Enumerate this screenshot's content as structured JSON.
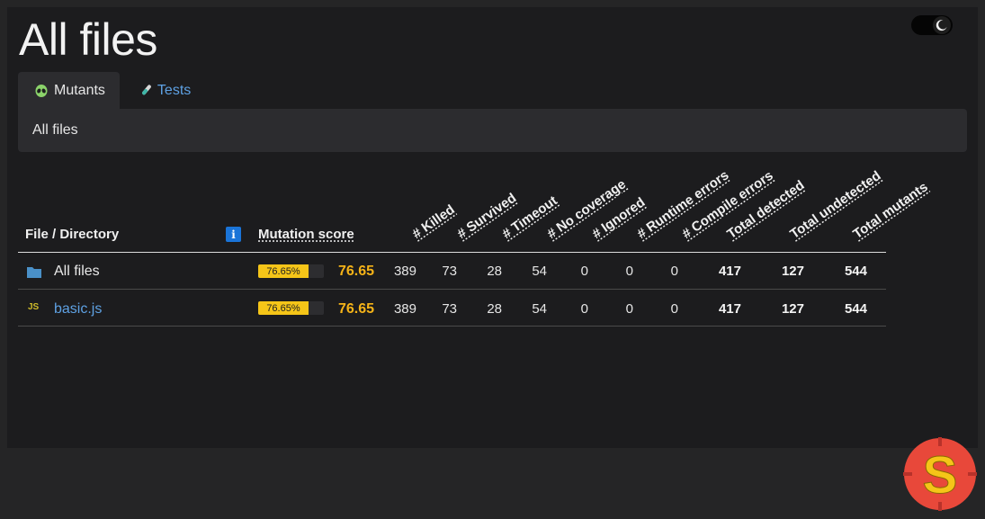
{
  "page": {
    "title": "All files",
    "theme_toggle": "dark"
  },
  "tabs": [
    {
      "label": "Mutants",
      "icon": "alien-icon",
      "active": true
    },
    {
      "label": "Tests",
      "icon": "test-tube-icon",
      "active": false
    }
  ],
  "breadcrumb": {
    "current": "All files"
  },
  "table": {
    "headers": {
      "file": "File / Directory",
      "info": "i",
      "score": "Mutation score",
      "killed": "# Killed",
      "survived": "# Survived",
      "timeout": "# Timeout",
      "no_coverage": "# No coverage",
      "ignored": "# Ignored",
      "runtime_errors": "# Runtime errors",
      "compile_errors": "# Compile errors",
      "total_detected": "Total detected",
      "total_undetected": "Total undetected",
      "total_mutants": "Total mutants"
    },
    "rows": [
      {
        "name": "All files",
        "icon": "folder-icon",
        "is_link": false,
        "score_pct": 76.65,
        "bar_label": "76.65%",
        "score": "76.65",
        "killed": "389",
        "survived": "73",
        "timeout": "28",
        "no_coverage": "54",
        "ignored": "0",
        "runtime_errors": "0",
        "compile_errors": "0",
        "total_detected": "417",
        "total_undetected": "127",
        "total_mutants": "544"
      },
      {
        "name": "basic.js",
        "icon": "js-file-icon",
        "is_link": true,
        "score_pct": 76.65,
        "bar_label": "76.65%",
        "score": "76.65",
        "killed": "389",
        "survived": "73",
        "timeout": "28",
        "no_coverage": "54",
        "ignored": "0",
        "runtime_errors": "0",
        "compile_errors": "0",
        "total_detected": "417",
        "total_undetected": "127",
        "total_mutants": "544"
      }
    ]
  },
  "logo": {
    "letter": "S"
  },
  "colors": {
    "accent_link": "#5ea1e3",
    "score_warning": "#f5b318",
    "bar_fill": "#f5c518",
    "logo_red": "#e74c3c",
    "logo_yellow": "#f5c518"
  }
}
